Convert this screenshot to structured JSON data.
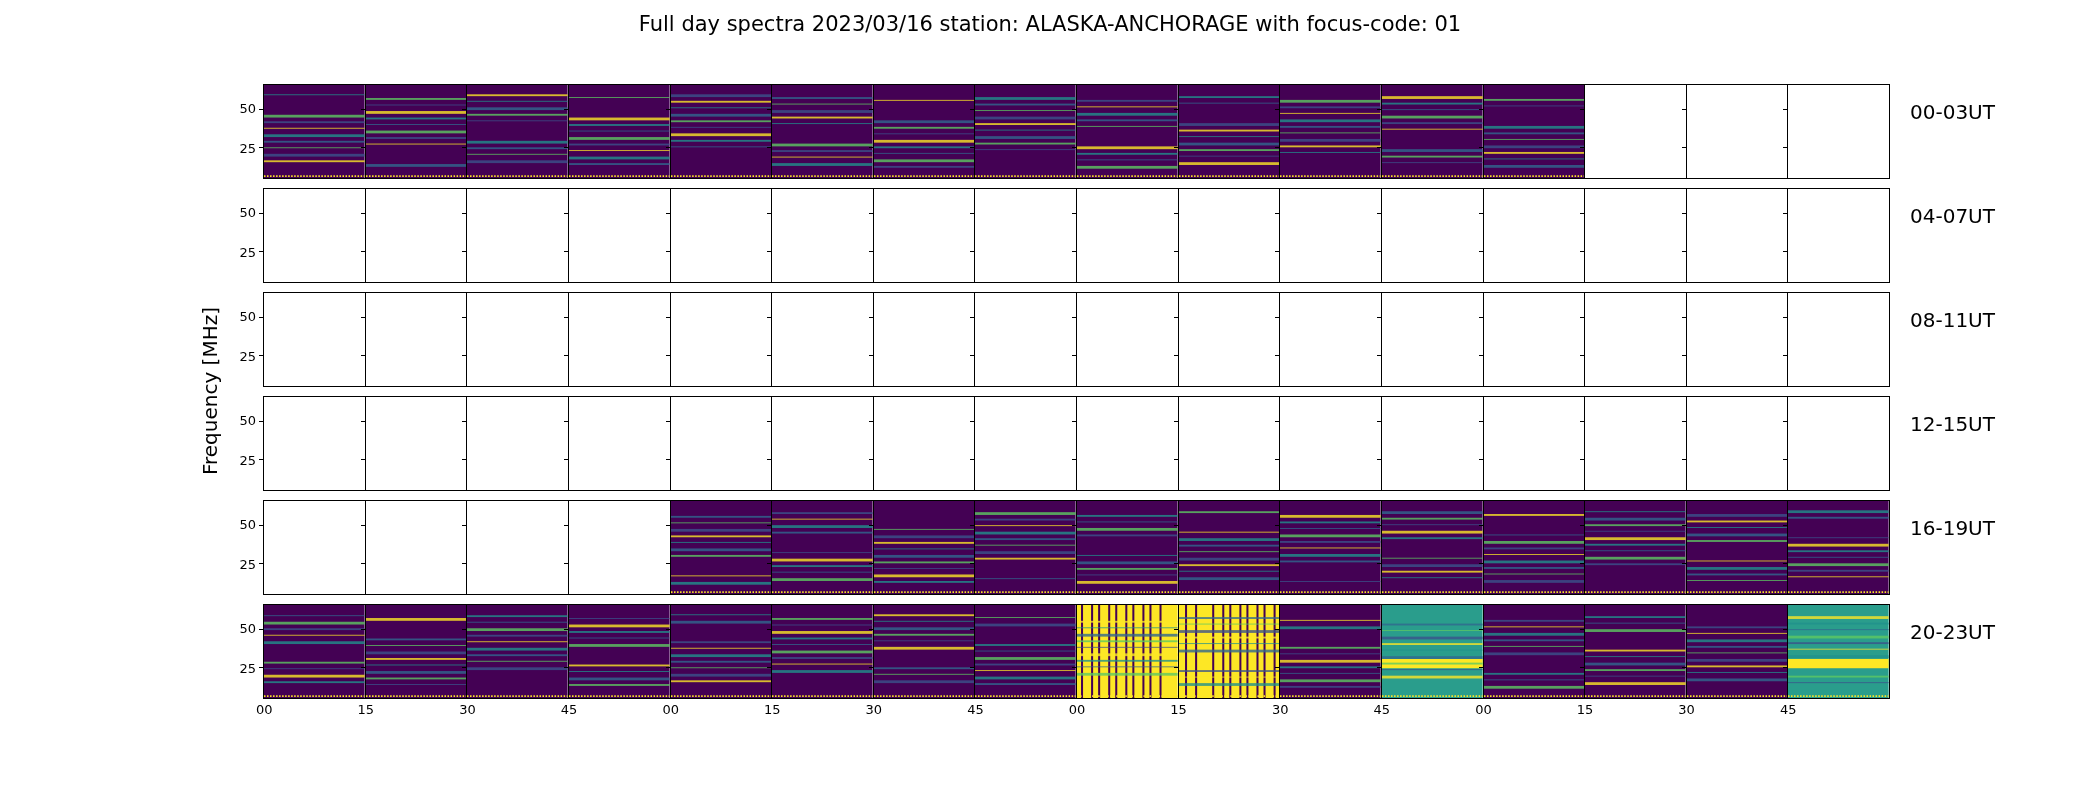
{
  "title": "Full day spectra 2023/03/16 station: ALASKA-ANCHORAGE with focus-code: 01",
  "ylabel": "Frequency [MHz]",
  "rows": [
    {
      "label": "00-03UT",
      "yticks": [
        "50",
        "25"
      ],
      "panels": [
        {
          "kind": "spectrum"
        },
        {
          "kind": "spectrum"
        },
        {
          "kind": "spectrum"
        },
        {
          "kind": "spectrum"
        },
        {
          "kind": "spectrum"
        },
        {
          "kind": "spectrum"
        },
        {
          "kind": "spectrum"
        },
        {
          "kind": "spectrum"
        },
        {
          "kind": "spectrum"
        },
        {
          "kind": "spectrum"
        },
        {
          "kind": "spectrum"
        },
        {
          "kind": "spectrum"
        },
        {
          "kind": "spectrum"
        },
        {
          "kind": "empty"
        },
        {
          "kind": "empty"
        },
        {
          "kind": "empty"
        }
      ]
    },
    {
      "label": "04-07UT",
      "yticks": [
        "50",
        "25"
      ],
      "panels": [
        {
          "kind": "empty"
        },
        {
          "kind": "empty"
        },
        {
          "kind": "empty"
        },
        {
          "kind": "empty"
        },
        {
          "kind": "empty"
        },
        {
          "kind": "empty"
        },
        {
          "kind": "empty"
        },
        {
          "kind": "empty"
        },
        {
          "kind": "empty"
        },
        {
          "kind": "empty"
        },
        {
          "kind": "empty"
        },
        {
          "kind": "empty"
        },
        {
          "kind": "empty"
        },
        {
          "kind": "empty"
        },
        {
          "kind": "empty"
        },
        {
          "kind": "empty"
        }
      ]
    },
    {
      "label": "08-11UT",
      "yticks": [
        "50",
        "25"
      ],
      "panels": [
        {
          "kind": "empty"
        },
        {
          "kind": "empty"
        },
        {
          "kind": "empty"
        },
        {
          "kind": "empty"
        },
        {
          "kind": "empty"
        },
        {
          "kind": "empty"
        },
        {
          "kind": "empty"
        },
        {
          "kind": "empty"
        },
        {
          "kind": "empty"
        },
        {
          "kind": "empty"
        },
        {
          "kind": "empty"
        },
        {
          "kind": "empty"
        },
        {
          "kind": "empty"
        },
        {
          "kind": "empty"
        },
        {
          "kind": "empty"
        },
        {
          "kind": "empty"
        }
      ]
    },
    {
      "label": "12-15UT",
      "yticks": [
        "50",
        "25"
      ],
      "panels": [
        {
          "kind": "empty"
        },
        {
          "kind": "empty"
        },
        {
          "kind": "empty"
        },
        {
          "kind": "empty"
        },
        {
          "kind": "empty"
        },
        {
          "kind": "empty"
        },
        {
          "kind": "empty"
        },
        {
          "kind": "empty"
        },
        {
          "kind": "empty"
        },
        {
          "kind": "empty"
        },
        {
          "kind": "empty"
        },
        {
          "kind": "empty"
        },
        {
          "kind": "empty"
        },
        {
          "kind": "empty"
        },
        {
          "kind": "empty"
        },
        {
          "kind": "empty"
        }
      ]
    },
    {
      "label": "16-19UT",
      "yticks": [
        "50",
        "25"
      ],
      "panels": [
        {
          "kind": "empty"
        },
        {
          "kind": "empty"
        },
        {
          "kind": "empty"
        },
        {
          "kind": "empty"
        },
        {
          "kind": "spectrum"
        },
        {
          "kind": "spectrum"
        },
        {
          "kind": "spectrum"
        },
        {
          "kind": "spectrum"
        },
        {
          "kind": "spectrum"
        },
        {
          "kind": "spectrum"
        },
        {
          "kind": "spectrum"
        },
        {
          "kind": "spectrum"
        },
        {
          "kind": "spectrum"
        },
        {
          "kind": "spectrum"
        },
        {
          "kind": "spectrum"
        },
        {
          "kind": "spectrum"
        }
      ]
    },
    {
      "label": "20-23UT",
      "yticks": [
        "50",
        "25"
      ],
      "panels": [
        {
          "kind": "spectrum"
        },
        {
          "kind": "spectrum"
        },
        {
          "kind": "spectrum"
        },
        {
          "kind": "spectrum"
        },
        {
          "kind": "spectrum"
        },
        {
          "kind": "spectrum"
        },
        {
          "kind": "spectrum"
        },
        {
          "kind": "spectrum"
        },
        {
          "kind": "saturated"
        },
        {
          "kind": "saturated"
        },
        {
          "kind": "spectrum"
        },
        {
          "kind": "elevated"
        },
        {
          "kind": "spectrum"
        },
        {
          "kind": "spectrum"
        },
        {
          "kind": "spectrum"
        },
        {
          "kind": "elevated"
        }
      ]
    }
  ],
  "xticks": [
    "00",
    "15",
    "30",
    "45",
    "00",
    "15",
    "30",
    "45",
    "00",
    "15",
    "30",
    "45",
    "00",
    "15",
    "30",
    "45"
  ]
}
